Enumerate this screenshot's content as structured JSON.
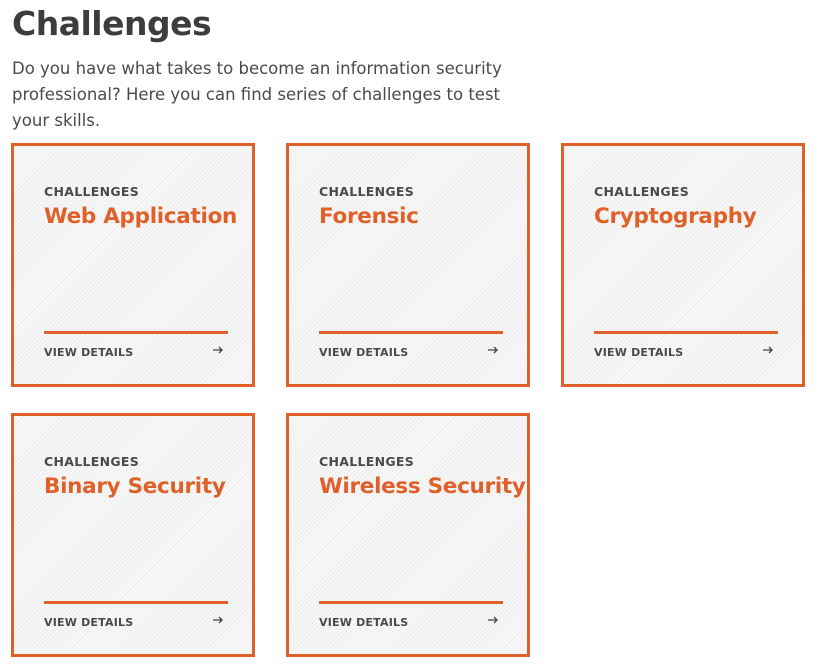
{
  "page": {
    "title": "Challenges",
    "intro": "Do you have what takes to become an information security professional? Here you can find series of challenges to test your skills."
  },
  "cards": [
    {
      "kicker": "CHALLENGES",
      "title": "Web Application",
      "link_label": "VIEW DETAILS",
      "icon": "arrow-right-icon"
    },
    {
      "kicker": "CHALLENGES",
      "title": "Forensic",
      "link_label": "VIEW DETAILS",
      "icon": "arrow-right-icon"
    },
    {
      "kicker": "CHALLENGES",
      "title": "Cryptography",
      "link_label": "VIEW DETAILS",
      "icon": "arrow-right-icon"
    },
    {
      "kicker": "CHALLENGES",
      "title": "Binary Security",
      "link_label": "VIEW DETAILS",
      "icon": "arrow-right-icon"
    },
    {
      "kicker": "CHALLENGES",
      "title": "Wireless Security",
      "link_label": "VIEW DETAILS",
      "icon": "arrow-right-icon"
    }
  ],
  "colors": {
    "accent": "#e0602a",
    "heading": "#3d3d3d",
    "text": "#4a4a4a"
  }
}
